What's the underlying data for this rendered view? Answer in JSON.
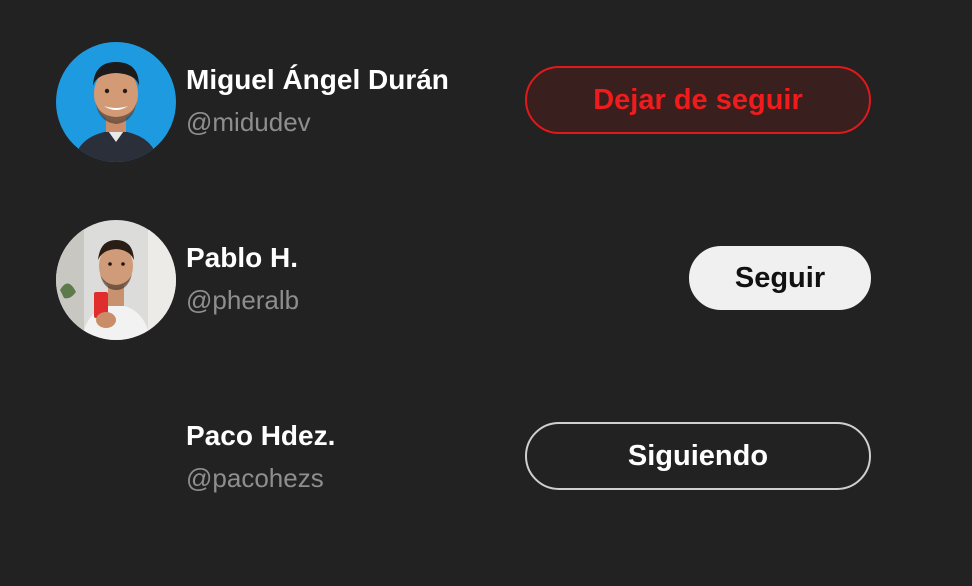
{
  "users": [
    {
      "name": "Miguel Ángel Durán",
      "handle": "@midudev",
      "button_label": "Dejar de seguir",
      "button_state": "unfollow-hover",
      "has_avatar": true
    },
    {
      "name": "Pablo H.",
      "handle": "@pheralb",
      "button_label": "Seguir",
      "button_state": "not-following",
      "has_avatar": true
    },
    {
      "name": "Paco Hdez.",
      "handle": "@pacohezs",
      "button_label": "Siguiendo",
      "button_state": "following",
      "has_avatar": false
    }
  ],
  "colors": {
    "background": "#222222",
    "unfollow_red": "#f21b1b",
    "handle_gray": "#8e8e8e"
  }
}
